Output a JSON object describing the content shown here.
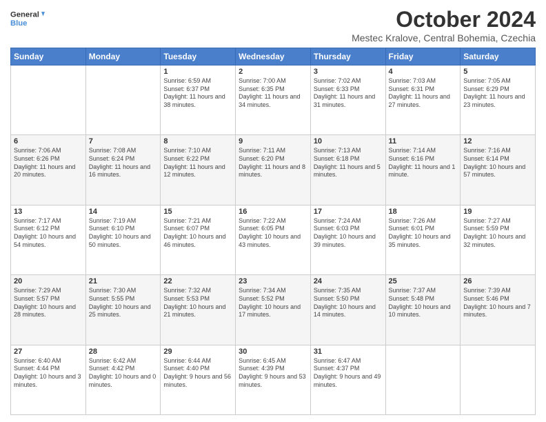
{
  "header": {
    "logo_general": "General",
    "logo_blue": "Blue",
    "month_title": "October 2024",
    "location": "Mestec Kralove, Central Bohemia, Czechia"
  },
  "days_of_week": [
    "Sunday",
    "Monday",
    "Tuesday",
    "Wednesday",
    "Thursday",
    "Friday",
    "Saturday"
  ],
  "weeks": [
    [
      {
        "day": "",
        "sunrise": "",
        "sunset": "",
        "daylight": ""
      },
      {
        "day": "",
        "sunrise": "",
        "sunset": "",
        "daylight": ""
      },
      {
        "day": "1",
        "sunrise": "Sunrise: 6:59 AM",
        "sunset": "Sunset: 6:37 PM",
        "daylight": "Daylight: 11 hours and 38 minutes."
      },
      {
        "day": "2",
        "sunrise": "Sunrise: 7:00 AM",
        "sunset": "Sunset: 6:35 PM",
        "daylight": "Daylight: 11 hours and 34 minutes."
      },
      {
        "day": "3",
        "sunrise": "Sunrise: 7:02 AM",
        "sunset": "Sunset: 6:33 PM",
        "daylight": "Daylight: 11 hours and 31 minutes."
      },
      {
        "day": "4",
        "sunrise": "Sunrise: 7:03 AM",
        "sunset": "Sunset: 6:31 PM",
        "daylight": "Daylight: 11 hours and 27 minutes."
      },
      {
        "day": "5",
        "sunrise": "Sunrise: 7:05 AM",
        "sunset": "Sunset: 6:29 PM",
        "daylight": "Daylight: 11 hours and 23 minutes."
      }
    ],
    [
      {
        "day": "6",
        "sunrise": "Sunrise: 7:06 AM",
        "sunset": "Sunset: 6:26 PM",
        "daylight": "Daylight: 11 hours and 20 minutes."
      },
      {
        "day": "7",
        "sunrise": "Sunrise: 7:08 AM",
        "sunset": "Sunset: 6:24 PM",
        "daylight": "Daylight: 11 hours and 16 minutes."
      },
      {
        "day": "8",
        "sunrise": "Sunrise: 7:10 AM",
        "sunset": "Sunset: 6:22 PM",
        "daylight": "Daylight: 11 hours and 12 minutes."
      },
      {
        "day": "9",
        "sunrise": "Sunrise: 7:11 AM",
        "sunset": "Sunset: 6:20 PM",
        "daylight": "Daylight: 11 hours and 8 minutes."
      },
      {
        "day": "10",
        "sunrise": "Sunrise: 7:13 AM",
        "sunset": "Sunset: 6:18 PM",
        "daylight": "Daylight: 11 hours and 5 minutes."
      },
      {
        "day": "11",
        "sunrise": "Sunrise: 7:14 AM",
        "sunset": "Sunset: 6:16 PM",
        "daylight": "Daylight: 11 hours and 1 minute."
      },
      {
        "day": "12",
        "sunrise": "Sunrise: 7:16 AM",
        "sunset": "Sunset: 6:14 PM",
        "daylight": "Daylight: 10 hours and 57 minutes."
      }
    ],
    [
      {
        "day": "13",
        "sunrise": "Sunrise: 7:17 AM",
        "sunset": "Sunset: 6:12 PM",
        "daylight": "Daylight: 10 hours and 54 minutes."
      },
      {
        "day": "14",
        "sunrise": "Sunrise: 7:19 AM",
        "sunset": "Sunset: 6:10 PM",
        "daylight": "Daylight: 10 hours and 50 minutes."
      },
      {
        "day": "15",
        "sunrise": "Sunrise: 7:21 AM",
        "sunset": "Sunset: 6:07 PM",
        "daylight": "Daylight: 10 hours and 46 minutes."
      },
      {
        "day": "16",
        "sunrise": "Sunrise: 7:22 AM",
        "sunset": "Sunset: 6:05 PM",
        "daylight": "Daylight: 10 hours and 43 minutes."
      },
      {
        "day": "17",
        "sunrise": "Sunrise: 7:24 AM",
        "sunset": "Sunset: 6:03 PM",
        "daylight": "Daylight: 10 hours and 39 minutes."
      },
      {
        "day": "18",
        "sunrise": "Sunrise: 7:26 AM",
        "sunset": "Sunset: 6:01 PM",
        "daylight": "Daylight: 10 hours and 35 minutes."
      },
      {
        "day": "19",
        "sunrise": "Sunrise: 7:27 AM",
        "sunset": "Sunset: 5:59 PM",
        "daylight": "Daylight: 10 hours and 32 minutes."
      }
    ],
    [
      {
        "day": "20",
        "sunrise": "Sunrise: 7:29 AM",
        "sunset": "Sunset: 5:57 PM",
        "daylight": "Daylight: 10 hours and 28 minutes."
      },
      {
        "day": "21",
        "sunrise": "Sunrise: 7:30 AM",
        "sunset": "Sunset: 5:55 PM",
        "daylight": "Daylight: 10 hours and 25 minutes."
      },
      {
        "day": "22",
        "sunrise": "Sunrise: 7:32 AM",
        "sunset": "Sunset: 5:53 PM",
        "daylight": "Daylight: 10 hours and 21 minutes."
      },
      {
        "day": "23",
        "sunrise": "Sunrise: 7:34 AM",
        "sunset": "Sunset: 5:52 PM",
        "daylight": "Daylight: 10 hours and 17 minutes."
      },
      {
        "day": "24",
        "sunrise": "Sunrise: 7:35 AM",
        "sunset": "Sunset: 5:50 PM",
        "daylight": "Daylight: 10 hours and 14 minutes."
      },
      {
        "day": "25",
        "sunrise": "Sunrise: 7:37 AM",
        "sunset": "Sunset: 5:48 PM",
        "daylight": "Daylight: 10 hours and 10 minutes."
      },
      {
        "day": "26",
        "sunrise": "Sunrise: 7:39 AM",
        "sunset": "Sunset: 5:46 PM",
        "daylight": "Daylight: 10 hours and 7 minutes."
      }
    ],
    [
      {
        "day": "27",
        "sunrise": "Sunrise: 6:40 AM",
        "sunset": "Sunset: 4:44 PM",
        "daylight": "Daylight: 10 hours and 3 minutes."
      },
      {
        "day": "28",
        "sunrise": "Sunrise: 6:42 AM",
        "sunset": "Sunset: 4:42 PM",
        "daylight": "Daylight: 10 hours and 0 minutes."
      },
      {
        "day": "29",
        "sunrise": "Sunrise: 6:44 AM",
        "sunset": "Sunset: 4:40 PM",
        "daylight": "Daylight: 9 hours and 56 minutes."
      },
      {
        "day": "30",
        "sunrise": "Sunrise: 6:45 AM",
        "sunset": "Sunset: 4:39 PM",
        "daylight": "Daylight: 9 hours and 53 minutes."
      },
      {
        "day": "31",
        "sunrise": "Sunrise: 6:47 AM",
        "sunset": "Sunset: 4:37 PM",
        "daylight": "Daylight: 9 hours and 49 minutes."
      },
      {
        "day": "",
        "sunrise": "",
        "sunset": "",
        "daylight": ""
      },
      {
        "day": "",
        "sunrise": "",
        "sunset": "",
        "daylight": ""
      }
    ]
  ]
}
